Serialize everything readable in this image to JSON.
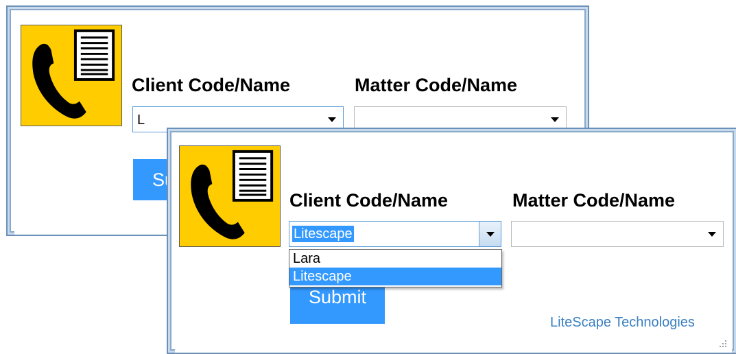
{
  "back_window": {
    "client_label": "Client Code/Name",
    "client_value": "L",
    "matter_label": "Matter Code/Name",
    "matter_value": "",
    "submit_label": "Submit"
  },
  "front_window": {
    "client_label": "Client Code/Name",
    "client_value": "Litescape",
    "matter_label": "Matter Code/Name",
    "matter_value": "",
    "dropdown_options": [
      "Lara",
      "Litescape"
    ],
    "dropdown_selected": "Litescape",
    "submit_label": "Submit",
    "footer_link": "LiteScape Technologies"
  },
  "icons": {
    "logo": "phone-with-list-icon",
    "combo_arrow": "chevron-down-icon"
  },
  "colors": {
    "accent": "#3399ff",
    "logo_bg": "#ffcc00",
    "link": "#3a7fc1"
  }
}
